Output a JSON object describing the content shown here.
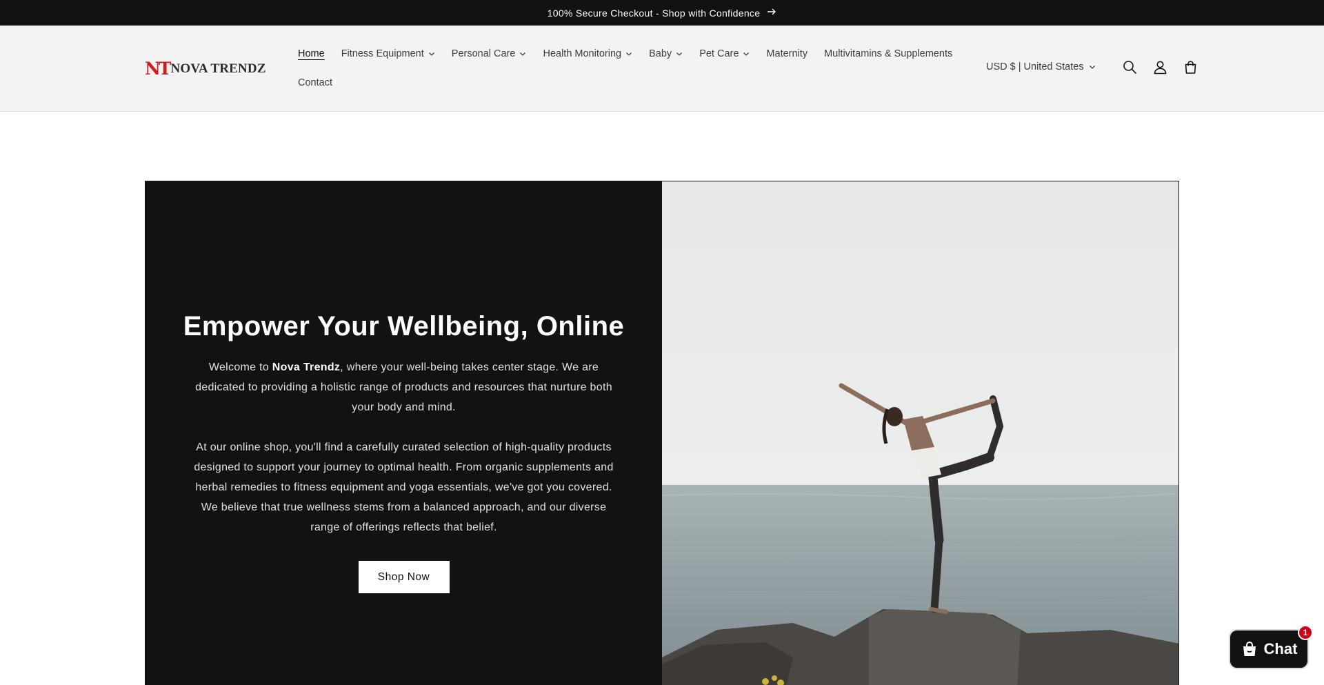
{
  "announcement": {
    "text": "100% Secure Checkout - Shop with Confidence",
    "arrow_icon": "arrow-right-icon"
  },
  "header": {
    "logo": {
      "mark": "NT",
      "text": "NOVA TRENDZ"
    },
    "nav": {
      "home": "Home",
      "fitness": "Fitness Equipment",
      "personal_care": "Personal Care",
      "health_monitoring": "Health Monitoring",
      "baby": "Baby",
      "pet_care": "Pet Care",
      "maternity": "Maternity",
      "multivitamins": "Multivitamins & Supplements",
      "contact": "Contact"
    },
    "currency": "USD $ | United States",
    "icons": [
      "search-icon",
      "account-icon",
      "cart-icon"
    ]
  },
  "hero": {
    "title": "Empower Your Wellbeing, Online",
    "p1_before": "Welcome to ",
    "p1_brand": "Nova Trendz",
    "p1_after": ", where your well-being takes center stage. We are dedicated to providing a holistic range of products and resources that nurture both your body and mind.",
    "p2": "At our online shop, you'll find a carefully curated selection of high-quality products designed to support your journey to optimal health. From organic supplements and herbal remedies to fitness equipment and yoga essentials, we've got you covered. We believe that true wellness stems from a balanced approach, and our diverse range of offerings reflects that belief.",
    "button": "Shop Now"
  },
  "chat": {
    "label": "Chat",
    "badge": "1"
  },
  "colors": {
    "dark": "#121212",
    "header_bg": "#f3f3f3",
    "logo_red": "#d81a1a",
    "badge_red": "#d0021b"
  }
}
